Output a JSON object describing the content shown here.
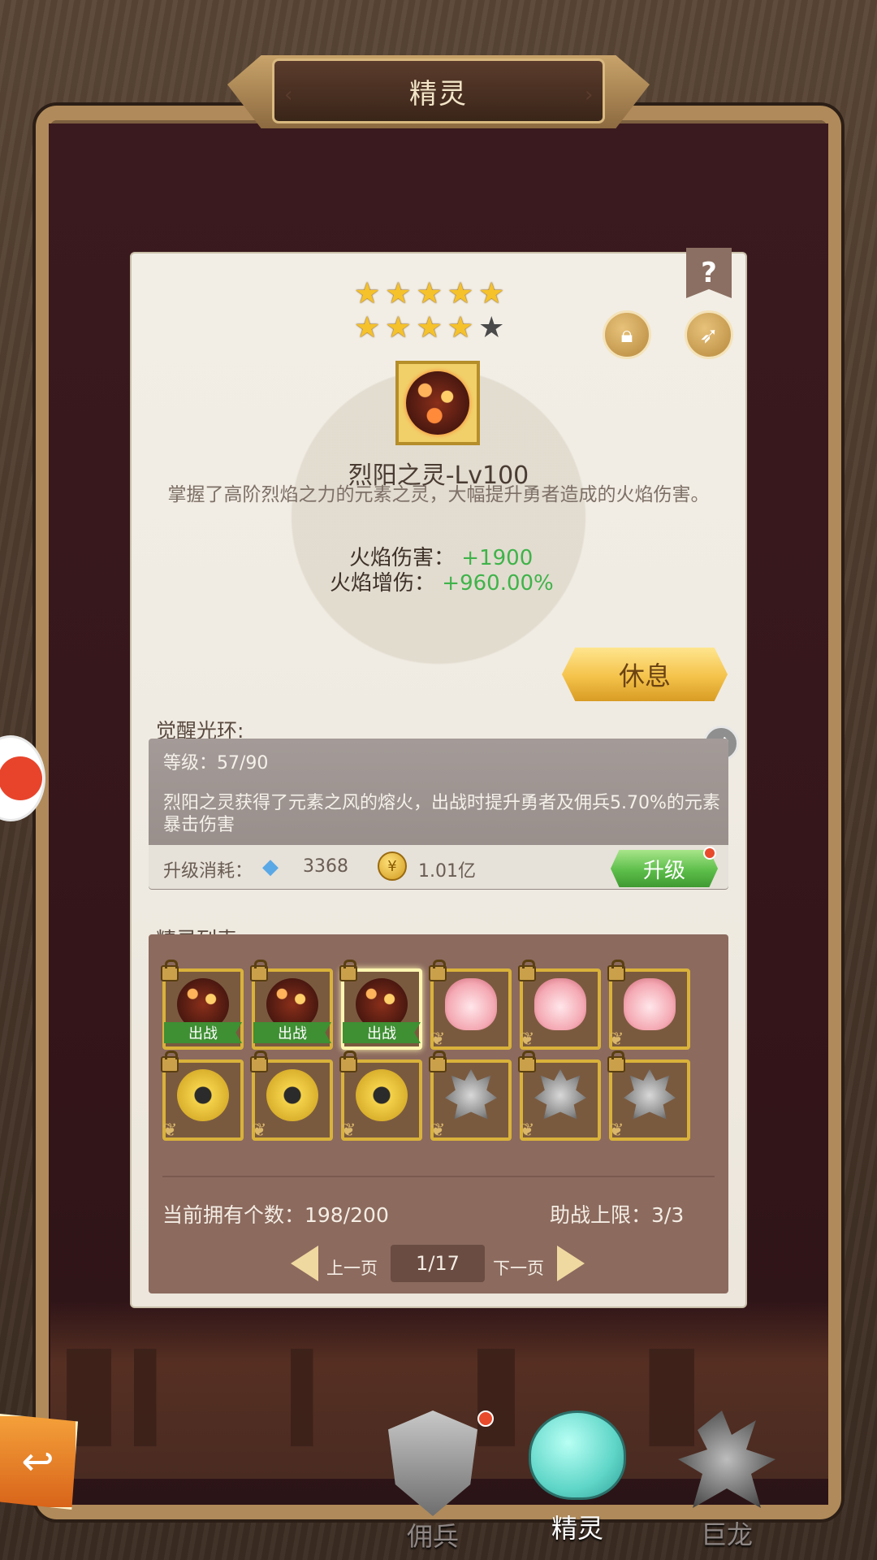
{
  "header": {
    "title": "精灵"
  },
  "spirit": {
    "stars_filled": 9,
    "stars_total": 10,
    "name": "烈阳之灵-Lv100",
    "description": "掌握了高阶烈焰之力的元素之灵，大幅提升勇者造成的火焰伤害。",
    "stats": [
      {
        "label": "火焰伤害：",
        "value": "+1900"
      },
      {
        "label": "火焰增伤：",
        "value": "+960.00%"
      }
    ],
    "rest_label": "休息",
    "help_label": "?"
  },
  "aura": {
    "section_label": "觉醒光环:",
    "level": "等级：57/90",
    "description": "烈阳之灵获得了元素之风的熔火，出战时提升勇者及佣兵5.70%的元素暴击伤害",
    "cost_label": "升级消耗：",
    "crystal_cost": "3368",
    "gold_cost": "1.01亿",
    "upgrade_label": "升级"
  },
  "list": {
    "section_label": "精灵列表:",
    "deploy_label": "出战",
    "owned": "当前拥有个数：198/200",
    "assist_limit": "助战上限：3/3",
    "prev_label": "上一页",
    "next_label": "下一页",
    "page": "1/17",
    "slots": [
      {
        "kind": "fire",
        "deployed": true
      },
      {
        "kind": "fire",
        "deployed": true
      },
      {
        "kind": "fire",
        "deployed": true
      },
      {
        "kind": "pink",
        "deployed": false
      },
      {
        "kind": "pink",
        "deployed": false
      },
      {
        "kind": "pink",
        "deployed": false
      },
      {
        "kind": "thunder",
        "deployed": false
      },
      {
        "kind": "thunder",
        "deployed": false
      },
      {
        "kind": "thunder",
        "deployed": false
      },
      {
        "kind": "steel",
        "deployed": false
      },
      {
        "kind": "steel",
        "deployed": false
      },
      {
        "kind": "steel",
        "deployed": false
      }
    ]
  },
  "tabs": [
    {
      "label": "佣兵",
      "icon": "mercenary-shield-icon",
      "active": false
    },
    {
      "label": "精灵",
      "icon": "spirit-slime-icon",
      "active": true
    },
    {
      "label": "巨龙",
      "icon": "dragon-icon",
      "active": false
    }
  ],
  "colors": {
    "gold": "#f4c24a",
    "green": "#3fb34a",
    "accent": "#e84a2c"
  }
}
